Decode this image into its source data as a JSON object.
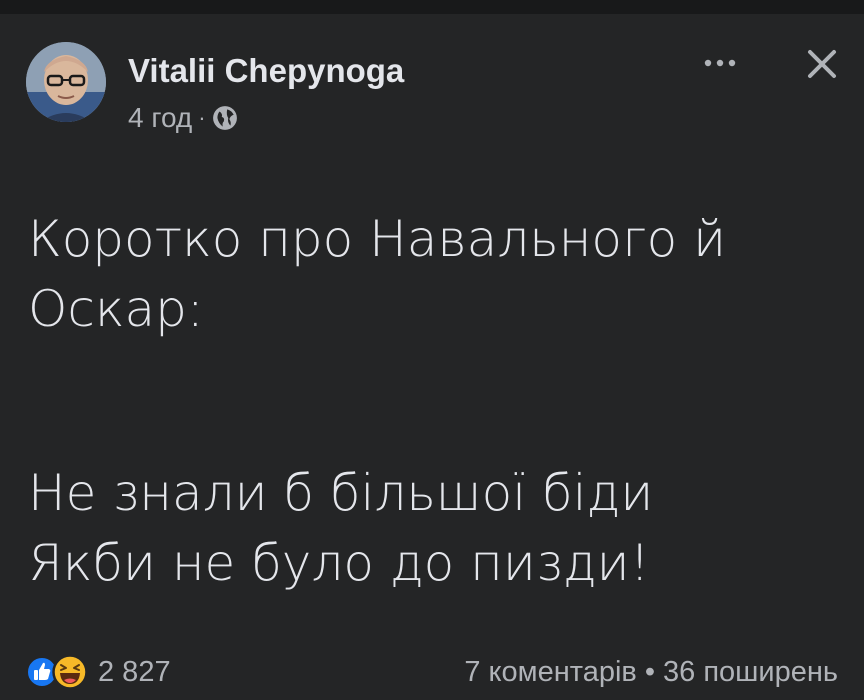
{
  "post": {
    "author": "Vitalii Chepynoga",
    "time": "4 год",
    "separator": "·",
    "lines_block1": [
      "Коротко про Навального й",
      "Оскар:"
    ],
    "lines_block2": [
      "Не знали б більшої біди",
      "Якби не було до пизди!"
    ]
  },
  "stats": {
    "reaction_count": "2 827",
    "comments": "7 коментарів",
    "dot": "•",
    "shares": "36 поширень"
  },
  "icons": {
    "privacy": "globe-icon",
    "more": "more-icon",
    "close": "close-icon",
    "reaction_1": "like-icon",
    "reaction_2": "haha-icon"
  },
  "colors": {
    "background": "#242526",
    "text_primary": "#e4e6eb",
    "text_secondary": "#b0b3b8",
    "like_blue": "#1877f2",
    "haha_yellow": "#f7b928"
  }
}
